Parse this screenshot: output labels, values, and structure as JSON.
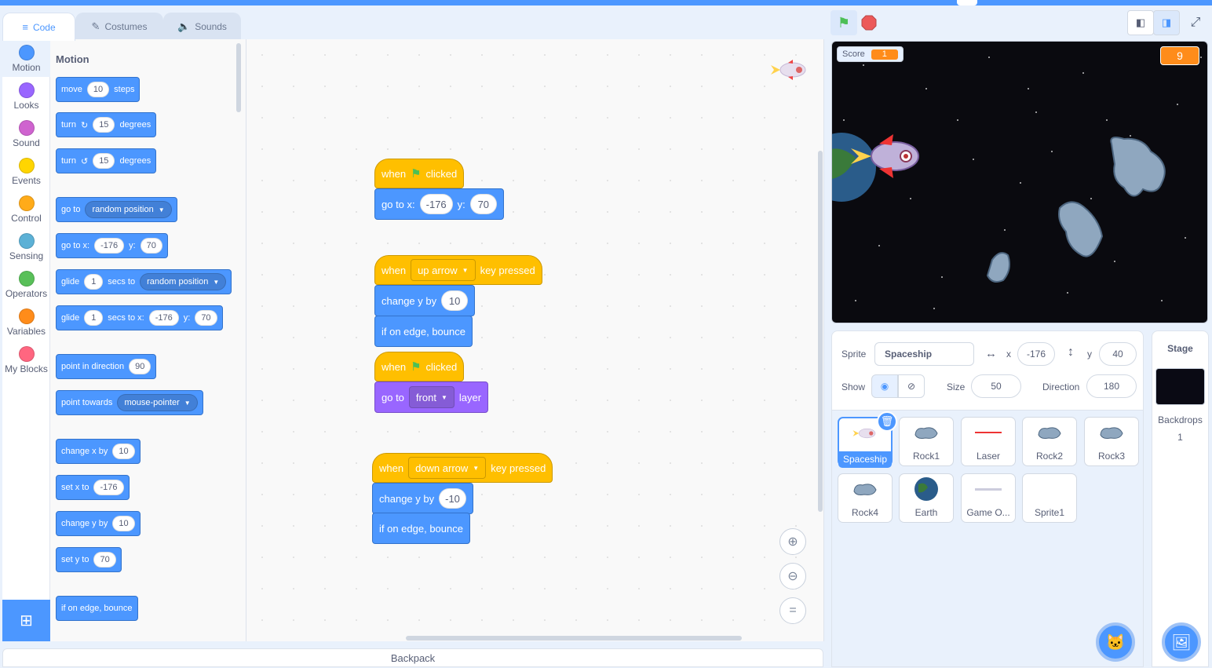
{
  "tabs": {
    "code": "Code",
    "costumes": "Costumes",
    "sounds": "Sounds"
  },
  "categories": [
    "Motion",
    "Looks",
    "Sound",
    "Events",
    "Control",
    "Sensing",
    "Operators",
    "Variables",
    "My Blocks"
  ],
  "category_colors": [
    "#4c97ff",
    "#9966ff",
    "#cf63cf",
    "#ffd500",
    "#ffab19",
    "#5cb1d6",
    "#59c059",
    "#ff8c1a",
    "#ff6680"
  ],
  "palette": {
    "heading": "Motion",
    "move": {
      "a": "move",
      "v": "10",
      "b": "steps"
    },
    "turn_right": {
      "a": "turn",
      "v": "15",
      "b": "degrees"
    },
    "turn_left": {
      "a": "turn",
      "v": "15",
      "b": "degrees"
    },
    "goto": {
      "a": "go to",
      "dd": "random position"
    },
    "gotoxy": {
      "a": "go to x:",
      "x": "-176",
      "b": "y:",
      "y": "70"
    },
    "glide1": {
      "a": "glide",
      "v": "1",
      "b": "secs to",
      "dd": "random position"
    },
    "glide2": {
      "a": "glide",
      "v": "1",
      "b": "secs to x:",
      "x": "-176",
      "c": "y:",
      "y": "70"
    },
    "point_dir": {
      "a": "point in direction",
      "v": "90"
    },
    "point_tow": {
      "a": "point towards",
      "dd": "mouse-pointer"
    },
    "changex": {
      "a": "change x by",
      "v": "10"
    },
    "setx": {
      "a": "set x to",
      "v": "-176"
    },
    "changey": {
      "a": "change y by",
      "v": "10"
    },
    "sety": {
      "a": "set y to",
      "v": "70"
    },
    "bounce": {
      "a": "if on edge, bounce"
    }
  },
  "script": {
    "s1_hat": {
      "a": "when",
      "b": "clicked"
    },
    "s1_goto": {
      "a": "go to x:",
      "x": "-176",
      "b": "y:",
      "y": "70"
    },
    "s2_hat": {
      "a": "when",
      "key": "up arrow",
      "b": "key pressed"
    },
    "s2_change": {
      "a": "change y by",
      "v": "10"
    },
    "s2_bounce": "if on edge, bounce",
    "s3_hat": {
      "a": "when",
      "b": "clicked"
    },
    "s3_layer": {
      "a": "go to",
      "dd": "front",
      "b": "layer"
    },
    "s4_hat": {
      "a": "when",
      "key": "down arrow",
      "b": "key pressed"
    },
    "s4_change": {
      "a": "change y by",
      "v": "-10"
    },
    "s4_bounce": "if on edge, bounce"
  },
  "zoom": {
    "reset": "="
  },
  "backpack": "Backpack",
  "stage": {
    "score_label": "Score",
    "score_value": "1",
    "timer_value": "9"
  },
  "sprite_info": {
    "sprite_label": "Sprite",
    "sprite_name": "Spaceship",
    "x_label": "x",
    "x": "-176",
    "y_label": "y",
    "y": "40",
    "show_label": "Show",
    "size_label": "Size",
    "size": "50",
    "direction_label": "Direction",
    "direction": "180"
  },
  "sprites": [
    "Spaceship",
    "Rock1",
    "Laser",
    "Rock2",
    "Rock3",
    "Rock4",
    "Earth",
    "Game O...",
    "Sprite1"
  ],
  "stage_pane": {
    "title": "Stage",
    "backdrops_label": "Backdrops",
    "backdrops_count": "1"
  }
}
